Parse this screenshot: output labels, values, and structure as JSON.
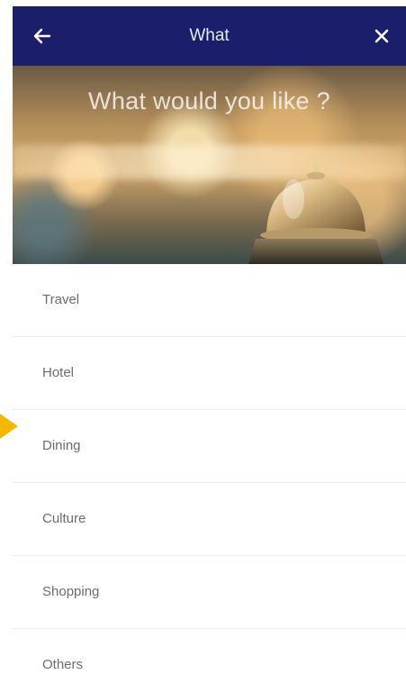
{
  "header": {
    "title": "What",
    "back_icon": "arrow-left-icon",
    "close_icon": "close-icon"
  },
  "hero": {
    "headline": "What would you like ?"
  },
  "list": {
    "items": [
      {
        "label": "Travel"
      },
      {
        "label": "Hotel"
      },
      {
        "label": "Dining"
      },
      {
        "label": "Culture"
      },
      {
        "label": "Shopping"
      },
      {
        "label": "Others"
      }
    ]
  },
  "pointer": {
    "icon": "arrow-pointer-icon",
    "color": "#f5b800"
  },
  "colors": {
    "header_bg": "#1b1f6b",
    "list_text": "#6b6b75",
    "divider": "#ececf0"
  }
}
